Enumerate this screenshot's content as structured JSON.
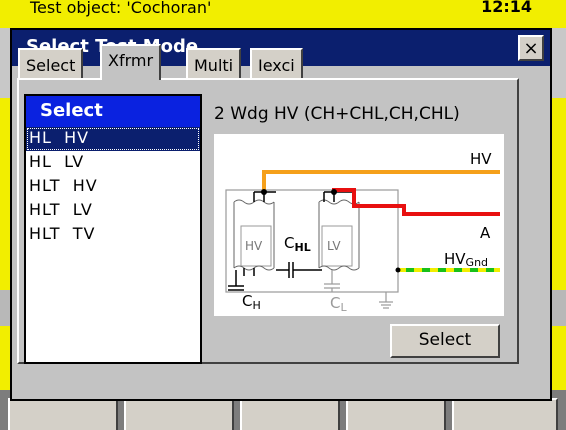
{
  "background": {
    "title_text": "Test object: 'Cochoran'",
    "clock": "12:14"
  },
  "dialog": {
    "title": "Select Test Mode",
    "close_glyph": "×",
    "tabs": [
      {
        "label": "Select",
        "active": false
      },
      {
        "label": "Xfrmr",
        "active": true
      },
      {
        "label": "Multi",
        "active": false
      },
      {
        "label": "Iexci",
        "active": false
      }
    ],
    "list": {
      "header": "Select",
      "items": [
        "HL  HV",
        "HL  LV",
        "HLT  HV",
        "HLT  LV",
        "HLT  TV"
      ],
      "selected_index": 0
    },
    "description": "2 Wdg HV (CH+CHL,CH,CHL)",
    "diagram": {
      "labels": {
        "hv": "HV",
        "a": "A",
        "hv_gnd_main": "HV",
        "hv_gnd_sub": "Gnd",
        "coil_hv": "HV",
        "coil_lv": "LV",
        "chl_main": "C",
        "chl_sub": "HL",
        "ch_main": "C",
        "ch_sub": "H",
        "cl_main": "C",
        "cl_sub": "L"
      },
      "colors": {
        "hv_lead": "#f5a01a",
        "a_lead": "#e81010",
        "gnd_lead_a": "#19c019",
        "gnd_lead_b": "#f2ee00"
      }
    },
    "select_button": "Select"
  }
}
